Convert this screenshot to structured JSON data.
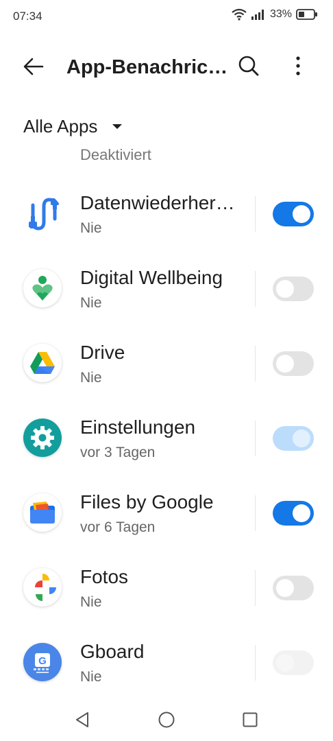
{
  "status_bar": {
    "time": "07:34",
    "battery": "33%"
  },
  "app_bar": {
    "title": "App-Benachrichtigungen"
  },
  "filter": {
    "label": "Alle Apps"
  },
  "partial_row": {
    "sub": "Deaktiviert"
  },
  "apps": [
    {
      "name": "Datenwiederherstellung",
      "sub": "Nie",
      "toggle": "on",
      "icon": "data-restore-icon"
    },
    {
      "name": "Digital Wellbeing",
      "sub": "Nie",
      "toggle": "off",
      "icon": "digital-wellbeing-icon"
    },
    {
      "name": "Drive",
      "sub": "Nie",
      "toggle": "off",
      "icon": "drive-icon"
    },
    {
      "name": "Einstellungen",
      "sub": "vor 3 Tagen",
      "toggle": "on-disabled",
      "icon": "settings-gear-icon"
    },
    {
      "name": "Files by Google",
      "sub": "vor 6 Tagen",
      "toggle": "on",
      "icon": "files-icon"
    },
    {
      "name": "Fotos",
      "sub": "Nie",
      "toggle": "off",
      "icon": "photos-pinwheel-icon"
    },
    {
      "name": "Gboard",
      "sub": "Nie",
      "toggle": "off-disabled",
      "icon": "gboard-icon"
    }
  ],
  "colors": {
    "accent": "#1478e6",
    "toggle_off": "#e3e3e3"
  }
}
